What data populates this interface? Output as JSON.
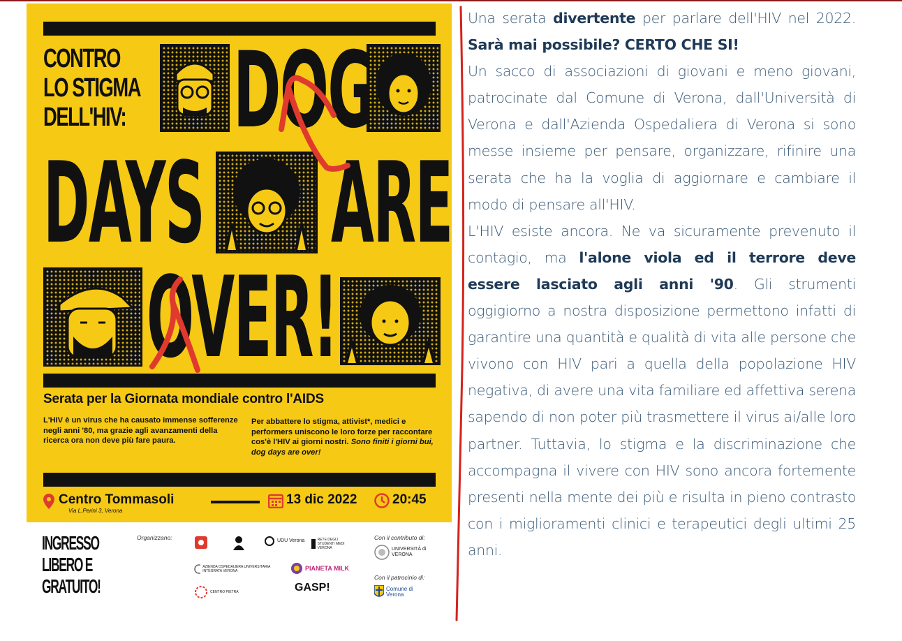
{
  "poster": {
    "header_lines": [
      "CONTRO",
      "LO STIGMA",
      "DELL'HIV:"
    ],
    "headline_words": [
      "DOG",
      "DAYS",
      "ARE",
      "OVER!"
    ],
    "subtitle": "Serata per la Giornata mondiale contro l'AIDS",
    "left_paragraph": "L'HIV è un virus che ha causato immense sofferenze negli anni '80, ma grazie agli avanzamenti della ricerca ora non deve più fare paura.",
    "right_paragraph": "Per abbattere lo stigma, attivist*, medici e performers uniscono le loro forze per raccontare cos'è l'HIV ai giorni nostri.",
    "right_paragraph_emphasis": "Sono finiti i giorni bui, dog days are over!",
    "venue": "Centro Tommasoli",
    "address": "Via L.Perini 3, Verona",
    "date": "13 dic 2022",
    "time": "20:45",
    "colors": {
      "background": "#f6c915",
      "ink": "#111111",
      "ribbon": "#e03a2f"
    }
  },
  "strip": {
    "free_entry_lines": [
      "INGRESSO",
      "LIBERO E",
      "GRATUITO!"
    ],
    "organizers_label": "Organizzano:",
    "contribution_label": "Con il contributo di:",
    "patronage_label": "Con il patrocinio di:",
    "logos": {
      "udu": "UDU Verona",
      "rete": "RETE DEGLI STUDENTI MEDI VERONA",
      "aoui": "AZIENDA OSPEDALIERA UNIVERSITARIA INTEGRATA VERONA",
      "pianeta_milk": "PIANETA MILK",
      "centro_pietra": "CENTRO PIETRA",
      "gasp": "GASP!",
      "univr": "UNIVERSITÀ di VERONA",
      "comune": "Comune di Verona"
    }
  },
  "article": {
    "p1_a": "Una serata ",
    "p1_b": "divertente",
    "p1_c": " per parlare dell'HIV nel 2022. ",
    "p1_d": "Sarà mai possibile? CERTO CHE SI!",
    "p2": "Un sacco di associazioni di giovani e meno giovani, patrocinate dal Comune di Verona, dall'Università di Verona e dall'Azienda Ospedaliera di Verona si sono messe insieme per pensare, organizzare, rifinire una serata che ha la voglia di aggiornare e cambiare il modo di pensare all'HIV.",
    "p3_a": "L'HIV esiste ancora. Ne va sicuramente prevenuto il contagio, ma ",
    "p3_b": "l'alone viola ed il terrore deve essere lasciato agli anni '90",
    "p3_c": ". Gli strumenti oggigiorno a nostra disposizione permettono infatti di garantire una quantità e qualità di vita alle persone che vivono con HIV pari a quella della popolazione HIV negativa, di avere una vita familiare ed affettiva serena sapendo di non poter più trasmettere il virus ai/alle loro partner. Tuttavia, lo stigma e la discriminazione che accompagna il vivere con HIV sono ancora fortemente presenti nella mente dei più e risulta in pieno contrasto con i miglioramenti clinici e terapeutici degli ultimi 25 anni."
  }
}
